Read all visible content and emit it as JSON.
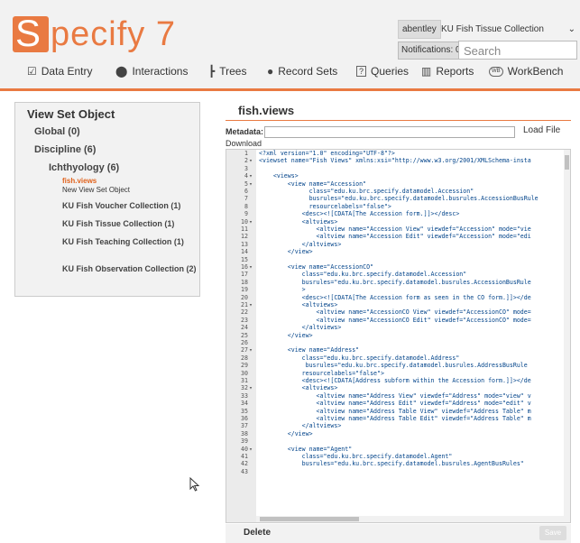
{
  "app": {
    "logo_letter": "S",
    "logo_text": "pecify 7"
  },
  "header": {
    "user": "abentley",
    "collection": "KU Fish Tissue Collection",
    "notifications": "Notifications: 0",
    "search_placeholder": "Search"
  },
  "nav": [
    {
      "label": "Data Entry",
      "icon": "data-entry-icon",
      "glyph": "☑"
    },
    {
      "label": "Interactions",
      "icon": "interactions-icon",
      "glyph": "⬤"
    },
    {
      "label": "Trees",
      "icon": "trees-icon",
      "glyph": "┣"
    },
    {
      "label": "Record Sets",
      "icon": "record-sets-icon",
      "glyph": "●"
    },
    {
      "label": "Queries",
      "icon": "queries-icon",
      "glyph": "?"
    },
    {
      "label": "Reports",
      "icon": "reports-icon",
      "glyph": "▥"
    },
    {
      "label": "WorkBench",
      "icon": "workbench-icon",
      "glyph": "WB"
    }
  ],
  "left": {
    "title": "View Set Object",
    "global": "Global (0)",
    "discipline": "Discipline (6)",
    "ichthyology": "Ichthyology (6)",
    "active_file": "fish.views",
    "new_object": "New View Set Object",
    "collections": [
      "KU Fish Voucher Collection (1)",
      "KU Fish Tissue Collection (1)",
      "KU Fish Teaching Collection (1)",
      "KU Fish Observation Collection (2)"
    ]
  },
  "right": {
    "title": "fish.views",
    "metadata_label": "Metadata:",
    "load_file": "Load File",
    "download": "Download",
    "delete": "Delete",
    "save": "Save"
  },
  "code": [
    {
      "n": "1",
      "f": "",
      "t": "<?xml version=\"1.0\" encoding=\"UTF-8\"?>"
    },
    {
      "n": "2",
      "f": "▾",
      "t": "<viewset name=\"Fish Views\" xmlns:xsi=\"http://www.w3.org/2001/XMLSchema-insta"
    },
    {
      "n": "3",
      "f": "",
      "t": ""
    },
    {
      "n": "4",
      "f": "▾",
      "t": "    <views>"
    },
    {
      "n": "5",
      "f": "▾",
      "t": "        <view name=\"Accession\""
    },
    {
      "n": "6",
      "f": "",
      "t": "              class=\"edu.ku.brc.specify.datamodel.Accession\""
    },
    {
      "n": "7",
      "f": "",
      "t": "              busrules=\"edu.ku.brc.specify.datamodel.busrules.AccessionBusRule"
    },
    {
      "n": "8",
      "f": "",
      "t": "              resourcelabels=\"false\">"
    },
    {
      "n": "9",
      "f": "",
      "t": "            <desc><![CDATA[The Accession form.]]></desc>"
    },
    {
      "n": "10",
      "f": "▾",
      "t": "            <altviews>"
    },
    {
      "n": "11",
      "f": "",
      "t": "                <altview name=\"Accession View\" viewdef=\"Accession\" mode=\"vie"
    },
    {
      "n": "12",
      "f": "",
      "t": "                <altview name=\"Accession Edit\" viewdef=\"Accession\" mode=\"edi"
    },
    {
      "n": "13",
      "f": "",
      "t": "            </altviews>"
    },
    {
      "n": "14",
      "f": "",
      "t": "        </view>"
    },
    {
      "n": "15",
      "f": "",
      "t": ""
    },
    {
      "n": "16",
      "f": "▾",
      "t": "        <view name=\"AccessionCO\""
    },
    {
      "n": "17",
      "f": "",
      "t": "            class=\"edu.ku.brc.specify.datamodel.Accession\""
    },
    {
      "n": "18",
      "f": "",
      "t": "            busrules=\"edu.ku.brc.specify.datamodel.busrules.AccessionBusRule"
    },
    {
      "n": "19",
      "f": "",
      "t": "            >"
    },
    {
      "n": "20",
      "f": "",
      "t": "            <desc><![CDATA[The Accession form as seen in the CO form.]]></de"
    },
    {
      "n": "21",
      "f": "▾",
      "t": "            <altviews>"
    },
    {
      "n": "22",
      "f": "",
      "t": "                <altview name=\"AccessionCO View\" viewdef=\"AccessionCO\" mode="
    },
    {
      "n": "23",
      "f": "",
      "t": "                <altview name=\"AccessionCO Edit\" viewdef=\"AccessionCO\" mode="
    },
    {
      "n": "24",
      "f": "",
      "t": "            </altviews>"
    },
    {
      "n": "25",
      "f": "",
      "t": "        </view>"
    },
    {
      "n": "26",
      "f": "",
      "t": ""
    },
    {
      "n": "27",
      "f": "▾",
      "t": "        <view name=\"Address\""
    },
    {
      "n": "28",
      "f": "",
      "t": "            class=\"edu.ku.brc.specify.datamodel.Address\""
    },
    {
      "n": "29",
      "f": "",
      "t": "             busrules=\"edu.ku.brc.specify.datamodel.busrules.AddressBusRule"
    },
    {
      "n": "30",
      "f": "",
      "t": "            resourcelabels=\"false\">"
    },
    {
      "n": "31",
      "f": "",
      "t": "            <desc><![CDATA[Address subform within the Accession form.]]></de"
    },
    {
      "n": "32",
      "f": "▾",
      "t": "            <altviews>"
    },
    {
      "n": "33",
      "f": "",
      "t": "                <altview name=\"Address View\" viewdef=\"Address\" mode=\"view\" v"
    },
    {
      "n": "34",
      "f": "",
      "t": "                <altview name=\"Address Edit\" viewdef=\"Address\" mode=\"edit\" v"
    },
    {
      "n": "35",
      "f": "",
      "t": "                <altview name=\"Address Table View\" viewdef=\"Address Table\" m"
    },
    {
      "n": "36",
      "f": "",
      "t": "                <altview name=\"Address Table Edit\" viewdef=\"Address Table\" m"
    },
    {
      "n": "37",
      "f": "",
      "t": "            </altviews>"
    },
    {
      "n": "38",
      "f": "",
      "t": "        </view>"
    },
    {
      "n": "39",
      "f": "",
      "t": ""
    },
    {
      "n": "40",
      "f": "▾",
      "t": "        <view name=\"Agent\""
    },
    {
      "n": "41",
      "f": "",
      "t": "            class=\"edu.ku.brc.specify.datamodel.Agent\""
    },
    {
      "n": "42",
      "f": "",
      "t": "            busrules=\"edu.ku.brc.specify.datamodel.busrules.AgentBusRules\""
    },
    {
      "n": "43",
      "f": "",
      "t": ""
    }
  ]
}
